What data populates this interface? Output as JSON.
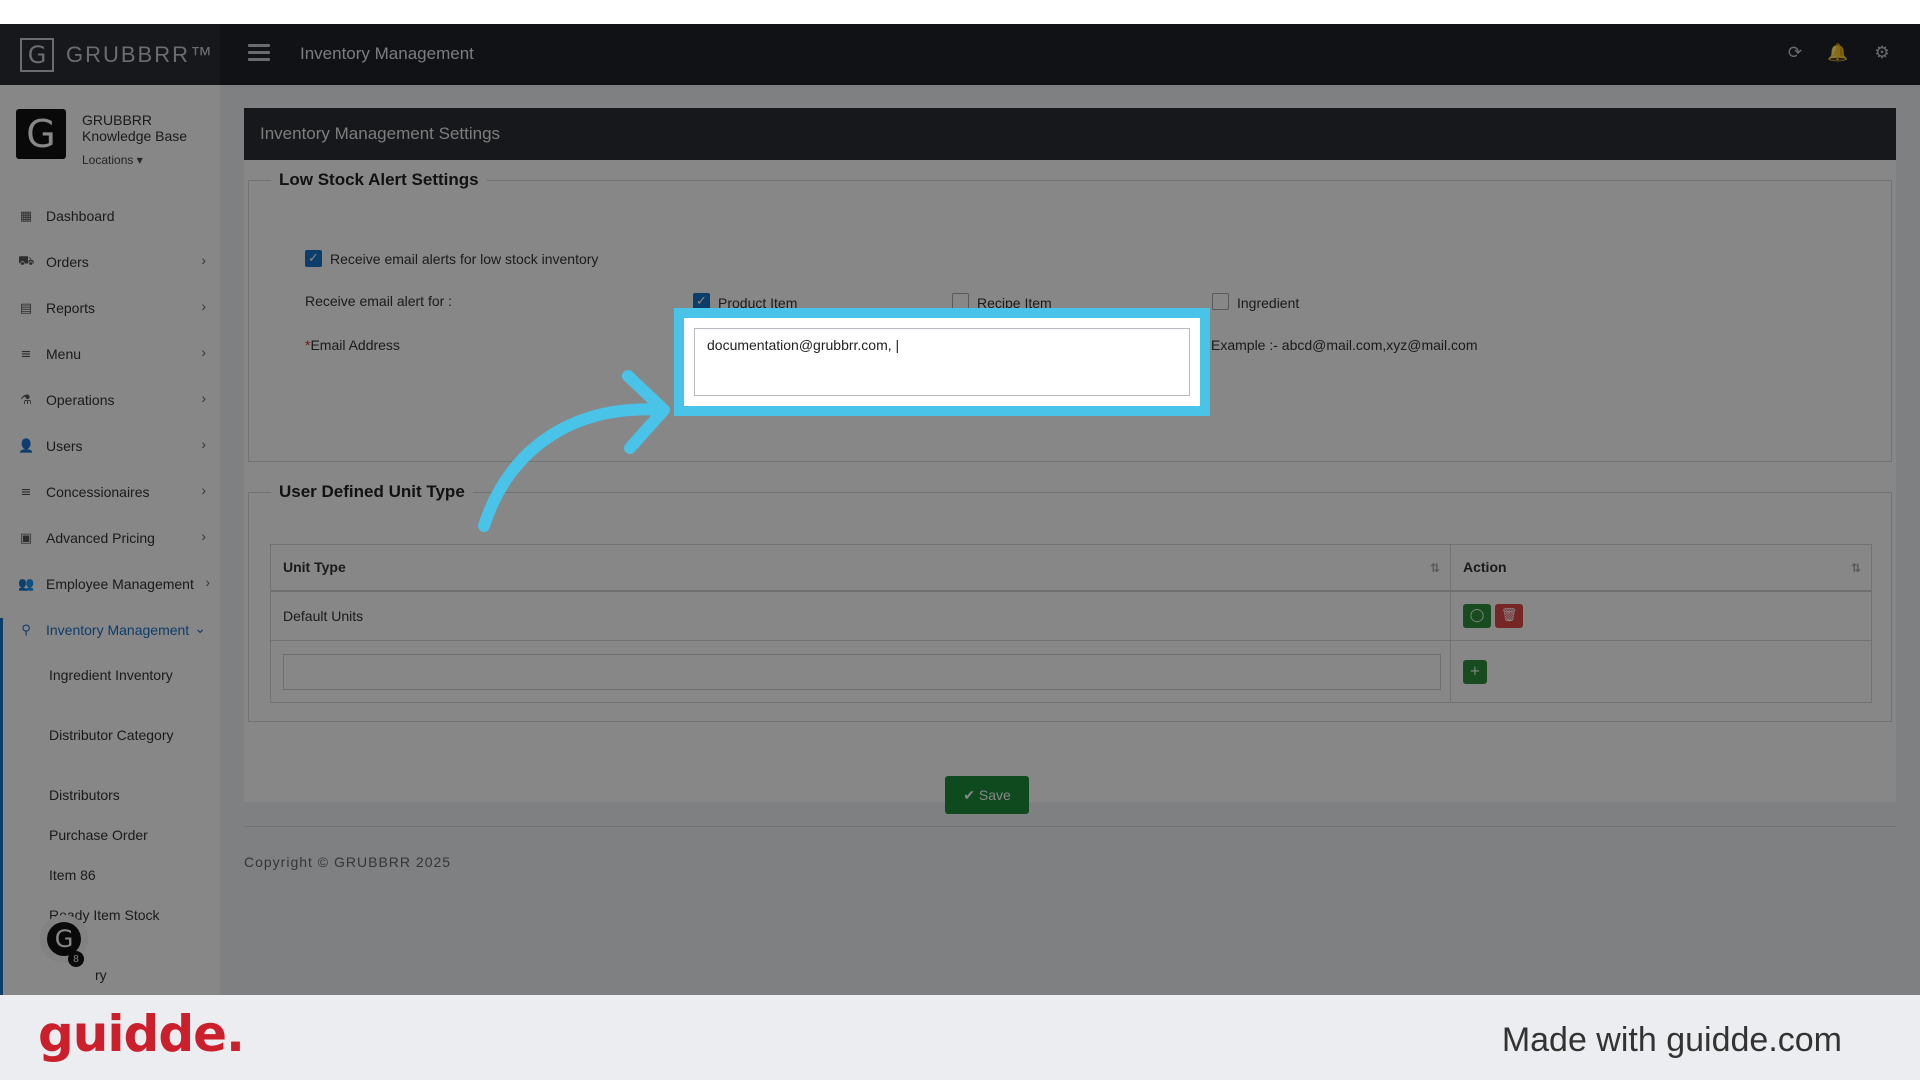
{
  "app": {
    "brand": "GRUBBRR™",
    "brand_logo_letter": "G",
    "title": "Inventory Management",
    "icons": [
      "refresh-icon",
      "bell-icon",
      "gear-icon"
    ]
  },
  "profile": {
    "avatar_letter": "G",
    "name": "GRUBBRR Knowledge Base",
    "locations_label": "Locations ▾"
  },
  "sidebar": {
    "items": [
      {
        "label": "Dashboard",
        "icon": "dashboard-icon",
        "glyph": "▦"
      },
      {
        "label": "Orders",
        "icon": "cart-icon",
        "glyph": "⛟"
      },
      {
        "label": "Reports",
        "icon": "document-icon",
        "glyph": "▤"
      },
      {
        "label": "Menu",
        "icon": "list-icon",
        "glyph": "≡"
      },
      {
        "label": "Operations",
        "icon": "flask-icon",
        "glyph": "⚗"
      },
      {
        "label": "Users",
        "icon": "add-user-icon",
        "glyph": "👤"
      },
      {
        "label": "Concessionaires",
        "icon": "list-icon",
        "glyph": "≡"
      },
      {
        "label": "Advanced Pricing",
        "icon": "money-icon",
        "glyph": "▣"
      },
      {
        "label": "Employee Management",
        "icon": "users-icon",
        "glyph": "👥"
      },
      {
        "label": "Inventory Management",
        "icon": "sitemap-icon",
        "glyph": "⚲"
      }
    ],
    "sub_items": [
      "Ingredient Inventory",
      "Distributor Category",
      "Distributors",
      "Purchase Order",
      "Item 86",
      "Ready Item Stock",
      "ry"
    ],
    "chat_badge": "8",
    "chat_letter": "G"
  },
  "settings": {
    "header": "Inventory Management Settings",
    "low_stock": {
      "legend": "Low Stock Alert Settings",
      "receive_alerts_label": "Receive email alerts for low stock inventory",
      "alert_for_label": "Receive email alert for :",
      "options": [
        "Product Item",
        "Recipe Item",
        "Ingredient"
      ],
      "email_label": "Email Address",
      "required_mark": "*",
      "email_value": "documentation@grubbrr.com, |",
      "example": "Example :- abcd@mail.com,xyz@mail.com"
    },
    "unit_type": {
      "legend": "User Defined Unit Type",
      "columns": [
        "Unit Type",
        "Action"
      ],
      "rows": [
        "Default Units"
      ]
    },
    "save_label": "✔ Save"
  },
  "footer": {
    "copyright": "Copyright © GRUBBRR 2025"
  },
  "banner": {
    "logo": "guidde.",
    "made_with": "Made with guidde.com"
  },
  "colors": {
    "highlight": "#49c3e8",
    "active_blue": "#1a73c9",
    "save_green": "#1e8a3a",
    "brand_red": "#cc1f2c"
  }
}
